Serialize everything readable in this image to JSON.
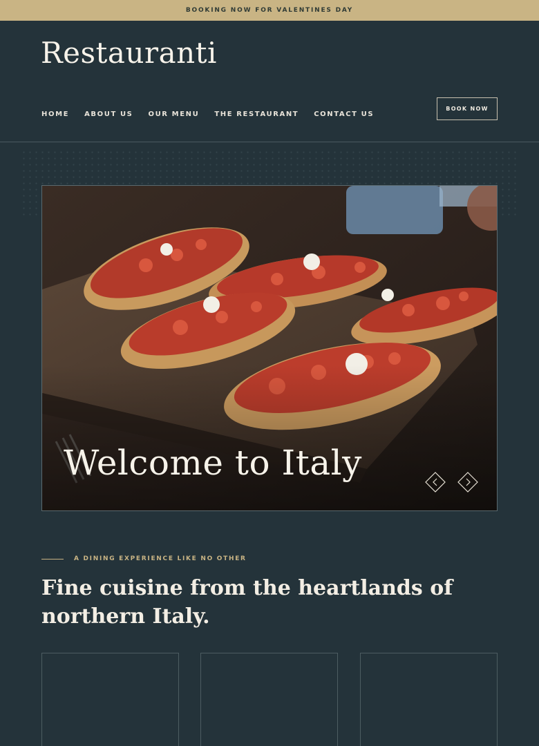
{
  "announcement": {
    "text": "BOOKING NOW FOR VALENTINES DAY"
  },
  "brand": {
    "logo": "Restauranti"
  },
  "nav": {
    "items": [
      {
        "label": "HOME"
      },
      {
        "label": "ABOUT US"
      },
      {
        "label": "OUR MENU"
      },
      {
        "label": "THE RESTAURANT"
      },
      {
        "label": "CONTACT US"
      }
    ],
    "book_label": "BOOK NOW"
  },
  "hero": {
    "title": "Welcome to Italy",
    "image_alt": "bruschetta-photo",
    "prev_icon": "chevron-left-diamond-icon",
    "next_icon": "chevron-right-diamond-icon"
  },
  "intro": {
    "eyebrow": "A DINING EXPERIENCE LIKE NO OTHER",
    "headline": "Fine cuisine from the heartlands of northern Italy."
  },
  "colors": {
    "background": "#24333a",
    "accent": "#c9b484",
    "text": "#f3eee4"
  }
}
